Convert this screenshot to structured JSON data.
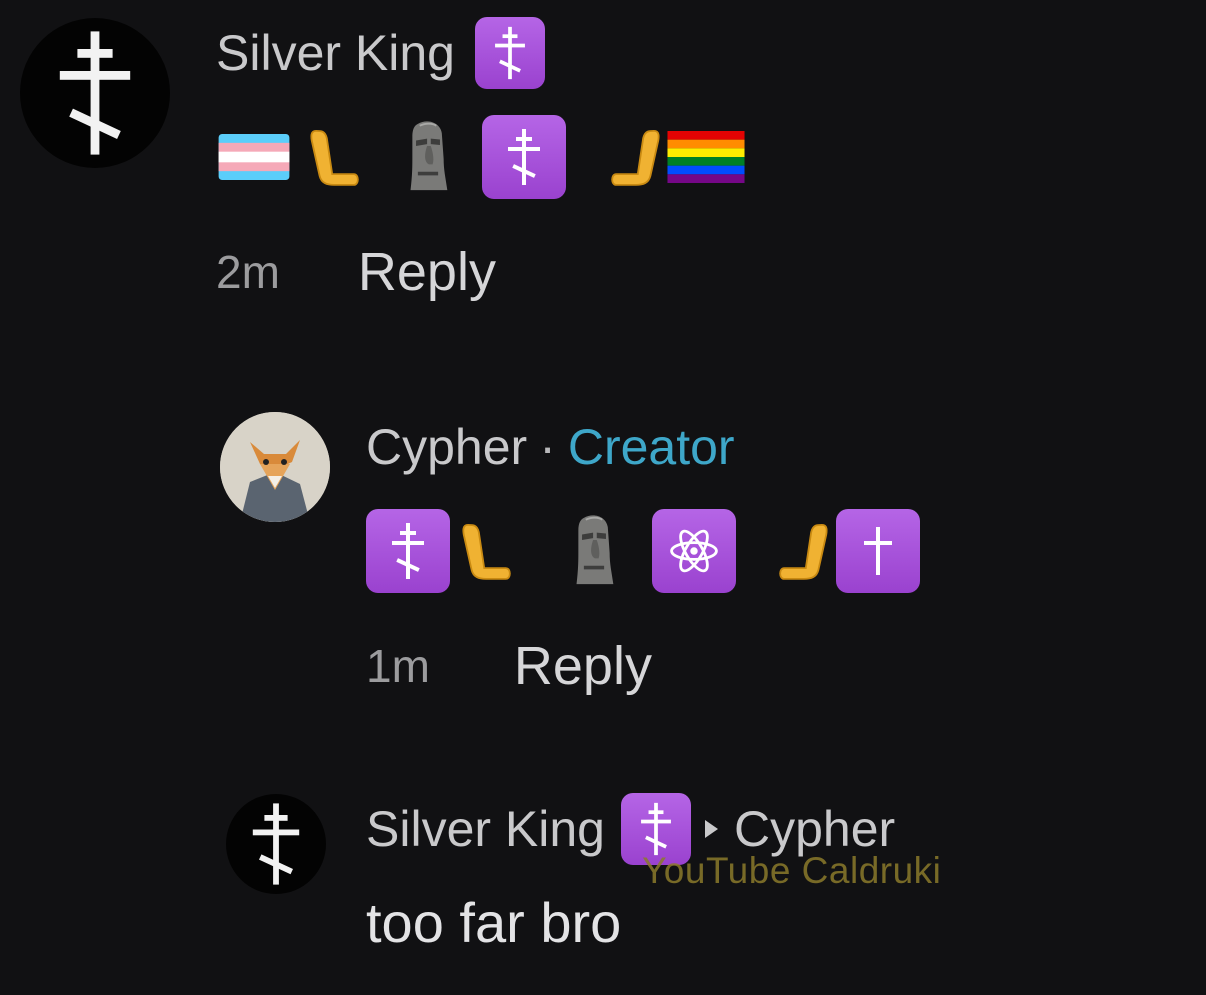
{
  "comments": [
    {
      "username": "Silver King",
      "timestamp": "2m",
      "reply_label": "Reply",
      "emoji_icons": [
        "transgender-flag-icon",
        "left-hand-icon",
        "moai-icon",
        "orthodox-cross-icon",
        "right-hand-icon",
        "rainbow-flag-icon"
      ]
    },
    {
      "username": "Cypher",
      "separator": "·",
      "creator_label": "Creator",
      "timestamp": "1m",
      "reply_label": "Reply",
      "emoji_icons": [
        "orthodox-cross-icon",
        "left-hand-icon",
        "moai-icon",
        "atom-icon",
        "right-hand-icon",
        "latin-cross-icon"
      ]
    },
    {
      "username": "Silver King",
      "reply_to": "Cypher",
      "text": "too far bro"
    }
  ],
  "watermark": "YouTube Caldruki",
  "colors": {
    "background": "#111113",
    "creator": "#3ea7c9",
    "badge": "#a04fd6",
    "watermark": "#8b7a2b"
  }
}
